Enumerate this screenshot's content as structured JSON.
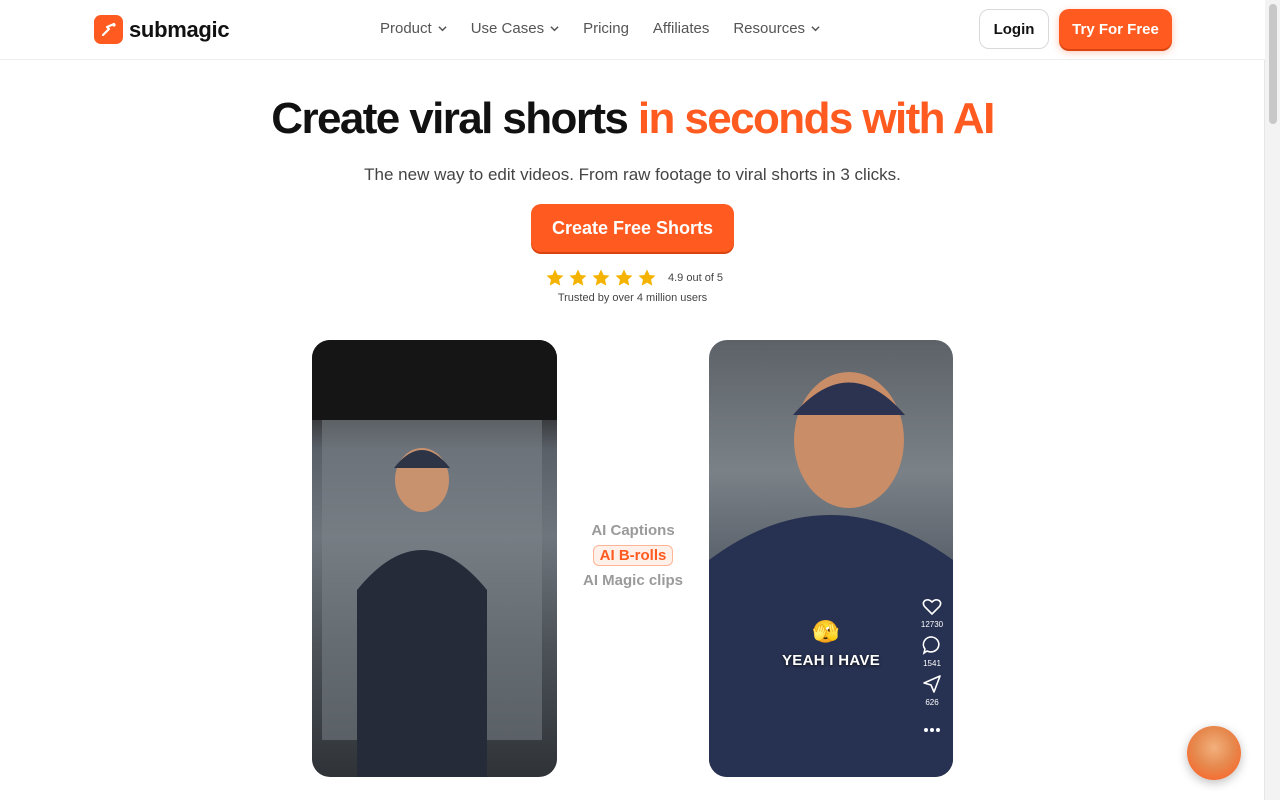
{
  "brand": {
    "name": "submagic",
    "accent_color": "#ff5a1f"
  },
  "nav": {
    "items": [
      {
        "label": "Product",
        "has_dropdown": true
      },
      {
        "label": "Use Cases",
        "has_dropdown": true
      },
      {
        "label": "Pricing",
        "has_dropdown": false
      },
      {
        "label": "Affiliates",
        "has_dropdown": false
      },
      {
        "label": "Resources",
        "has_dropdown": true
      }
    ],
    "login_label": "Login",
    "try_label": "Try For Free"
  },
  "hero": {
    "title_main": "Create viral shorts ",
    "title_accent": "in seconds with AI",
    "subtitle": "The new way to edit videos. From raw footage to viral shorts in 3 clicks.",
    "cta_label": "Create Free Shorts",
    "rating": {
      "stars": 5,
      "text": "4.9 out of 5"
    },
    "trusted_text": "Trusted by over 4 million users"
  },
  "features": [
    {
      "label": "AI Captions",
      "active": false
    },
    {
      "label": "AI B-rolls",
      "active": true
    },
    {
      "label": "AI Magic clips",
      "active": false
    }
  ],
  "preview": {
    "caption_emoji": "🫣",
    "caption_text": "YEAH I HAVE",
    "likes": "12730",
    "comments": "1541",
    "shares": "626"
  },
  "icons": [
    "logo-icon",
    "chevron-down-icon",
    "star-icon",
    "heart-icon",
    "comment-icon",
    "share-icon",
    "more-icon",
    "chat-avatar"
  ]
}
